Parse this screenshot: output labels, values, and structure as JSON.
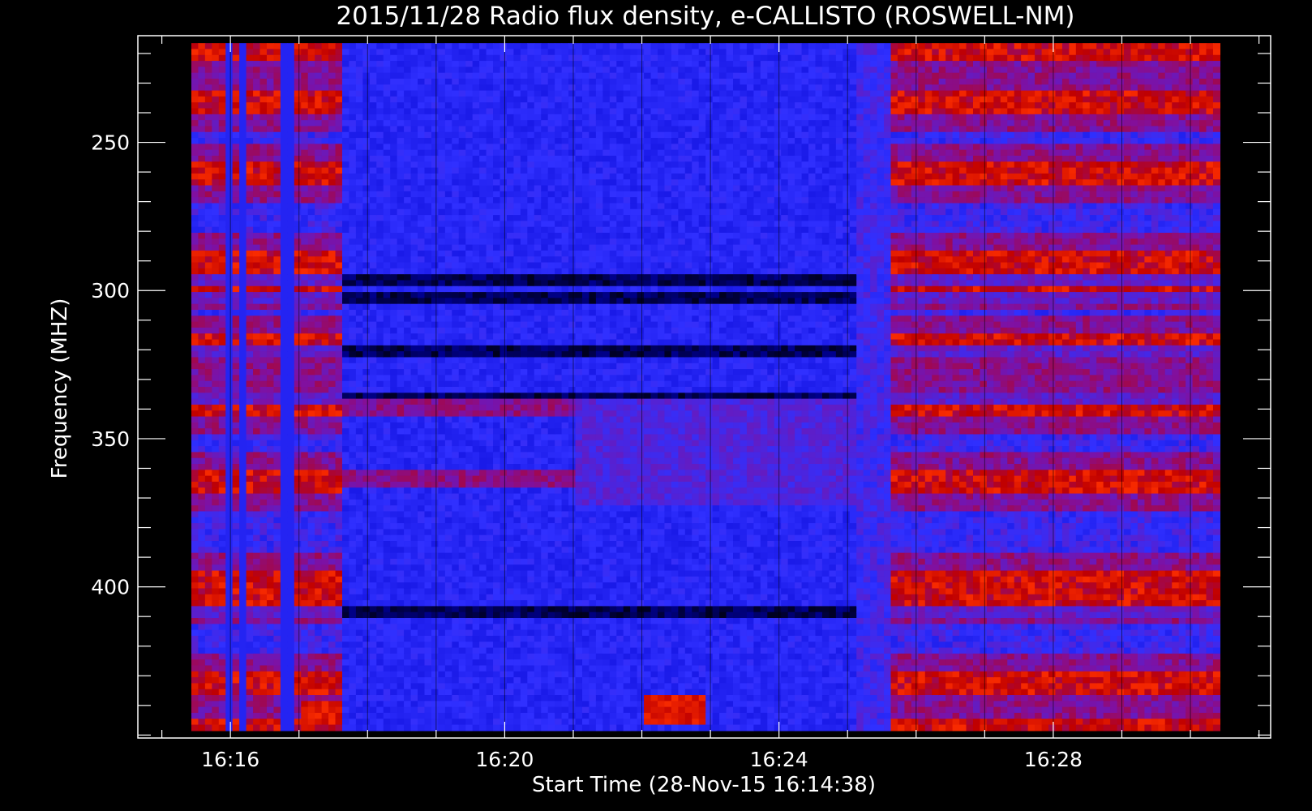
{
  "chart_data": {
    "type": "heatmap",
    "title": "2015/11/28  Radio flux density, e-CALLISTO (ROSWELL-NM)",
    "xlabel": "Start Time (28-Nov-15 16:14:38)",
    "ylabel": "Frequency (MHZ)",
    "x_ticks": [
      {
        "label": "16:16",
        "minutes": 16
      },
      {
        "label": "16:20",
        "minutes": 20
      },
      {
        "label": "16:24",
        "minutes": 24
      },
      {
        "label": "16:28",
        "minutes": 28
      }
    ],
    "y_ticks": [
      250,
      300,
      350,
      400
    ],
    "xlim_minutes": [
      14.65,
      31.17
    ],
    "ylim_mhz": [
      214,
      451
    ],
    "data_time_range_minutes": [
      15.43,
      30.43
    ],
    "data_freq_range_mhz": [
      216.5,
      448.5
    ],
    "colormap": [
      "#000000",
      "#0000cc",
      "#3030ff",
      "#8010a0",
      "#c00000",
      "#ff3000",
      "#ffc040",
      "#ffff80"
    ],
    "segments": [
      {
        "t_start": 15.43,
        "t_end": 17.62,
        "state": "flaring",
        "note": "vertical gaps near 16:16 and 16:17"
      },
      {
        "t_start": 17.62,
        "t_end": 25.05,
        "state": "quiet"
      },
      {
        "t_start": 25.05,
        "t_end": 25.55,
        "state": "transition"
      },
      {
        "t_start": 25.55,
        "t_end": 30.43,
        "state": "flaring"
      }
    ],
    "bright_bands_mhz": [
      218,
      235,
      260,
      290,
      296,
      318,
      338,
      363,
      398,
      402,
      432,
      447
    ],
    "dark_bands_mhz": [
      295,
      301,
      319,
      336,
      408
    ],
    "bursts": [
      {
        "t_start": 16.98,
        "t_end": 17.58,
        "f_low": 437,
        "f_high": 446
      },
      {
        "t_start": 21.95,
        "t_end": 22.85,
        "f_low": 436,
        "f_high": 446
      }
    ]
  }
}
